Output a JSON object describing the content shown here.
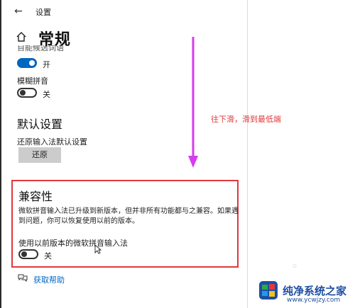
{
  "window": {
    "back_glyph": "←",
    "app_title": "设置"
  },
  "page": {
    "title": "常规",
    "cut_off_label": "自能候选词语"
  },
  "settings": {
    "toggle1_state": "开",
    "fuzzy_label": "模糊拼音",
    "fuzzy_state": "关",
    "defaults_heading": "默认设置",
    "restore_label": "还原输入法默认设置",
    "restore_button": "还原",
    "compat_heading": "兼容性",
    "compat_desc": "微软拼音输入法已升级到新版本，但并非所有功能都与之兼容。如果遇到问题，你可以恢复使用以前的版本。",
    "old_version_label": "使用以前版本的微软拼音输入法",
    "old_version_state": "关",
    "help_link": "获取帮助"
  },
  "annotation": {
    "text": "往下滑，滑到最低端",
    "color": "#e0383c",
    "arrow_color": "#d63cf0"
  },
  "watermark": {
    "brand": "纯净系统之家",
    "url": "www.ycwjzy.com"
  },
  "colors": {
    "accent": "#0067c0",
    "highlight_box": "#e0383c"
  }
}
